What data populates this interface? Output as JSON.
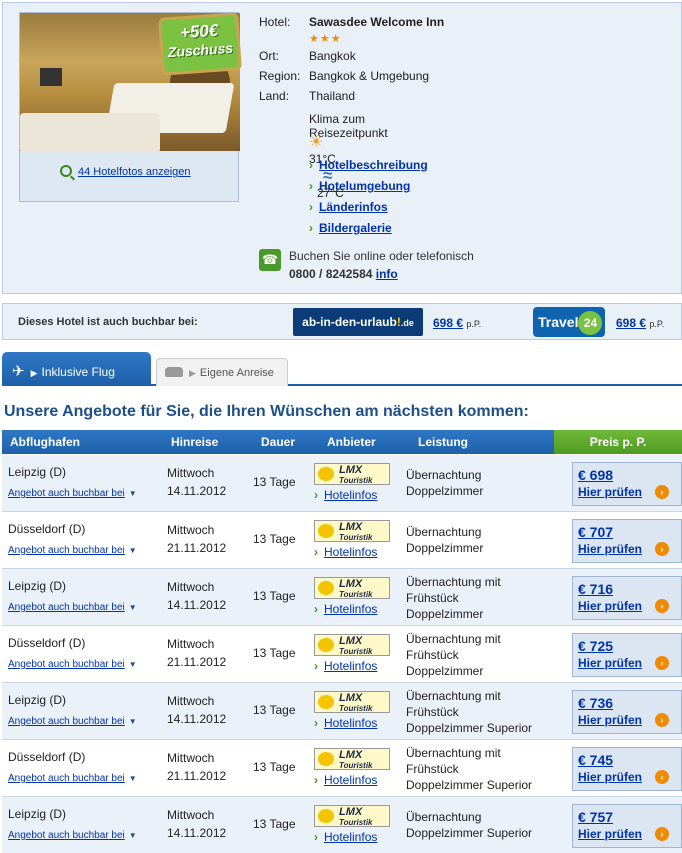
{
  "hotel": {
    "badge_line1": "+50€",
    "badge_line2": "Zuschuss",
    "photos_link": "44 Hotelfotos anzeigen",
    "labels": {
      "hotel": "Hotel:",
      "ort": "Ort:",
      "region": "Region:",
      "land": "Land:"
    },
    "name": "Sawasdee Welcome Inn",
    "stars": "★★★",
    "ort": "Bangkok",
    "region": "Bangkok & Umgebung",
    "land": "Thailand",
    "climate_title": "Klima zum Reisezeitpunkt",
    "air_temp": "31°C",
    "water_temp": "27°C",
    "links": [
      "Hotelbeschreibung",
      "Hotelumgebung",
      "Länderinfos",
      "Bildergalerie"
    ],
    "phone_text": "Buchen Sie online oder telefonisch",
    "phone_number": "0800 / 8242584",
    "phone_info": "info"
  },
  "also_bookable": {
    "label": "Dieses Hotel ist auch buchbar bei:",
    "partner1_logo_a": "ab-in-den-urlaub",
    "partner1_logo_b": "!",
    "partner1_logo_c": ".de",
    "partner1_price": "698 €",
    "partner2_logo": "Travel",
    "partner2_logo_num": "24",
    "partner2_price": "698 €",
    "pp": "p.P."
  },
  "tabs": {
    "active": "Inklusive Flug",
    "inactive": "Eigene Anreise"
  },
  "headline": "Unsere Angebote für Sie, die Ihren Wünschen am nächsten kommen:",
  "table": {
    "headers": {
      "abflughafen": "Abflughafen",
      "hinreise": "Hinreise",
      "dauer": "Dauer",
      "anbieter": "Anbieter",
      "leistung": "Leistung",
      "preis": "Preis p. P."
    },
    "also_link": "Angebot auch buchbar bei",
    "lmx": "LMX",
    "lmx_sub": "Touristik",
    "hotelinfos": "Hotelinfos",
    "check": "Hier prüfen",
    "rows": [
      {
        "airport": "Leipzig (D)",
        "weekday": "Mittwoch",
        "date": "14.11.2012",
        "duration": "13 Tage",
        "service1": "Übernachtung",
        "service2": "Doppelzimmer",
        "service3": "",
        "price": "€ 698"
      },
      {
        "airport": "Düsseldorf (D)",
        "weekday": "Mittwoch",
        "date": "21.11.2012",
        "duration": "13 Tage",
        "service1": "Übernachtung",
        "service2": "Doppelzimmer",
        "service3": "",
        "price": "€ 707"
      },
      {
        "airport": "Leipzig (D)",
        "weekday": "Mittwoch",
        "date": "14.11.2012",
        "duration": "13 Tage",
        "service1": "Übernachtung mit",
        "service2": "Frühstück",
        "service3": "Doppelzimmer",
        "price": "€ 716"
      },
      {
        "airport": "Düsseldorf (D)",
        "weekday": "Mittwoch",
        "date": "21.11.2012",
        "duration": "13 Tage",
        "service1": "Übernachtung mit",
        "service2": "Frühstück",
        "service3": "Doppelzimmer",
        "price": "€ 725"
      },
      {
        "airport": "Leipzig (D)",
        "weekday": "Mittwoch",
        "date": "14.11.2012",
        "duration": "13 Tage",
        "service1": "Übernachtung mit",
        "service2": "Frühstück",
        "service3": "Doppelzimmer Superior",
        "price": "€ 736"
      },
      {
        "airport": "Düsseldorf (D)",
        "weekday": "Mittwoch",
        "date": "21.11.2012",
        "duration": "13 Tage",
        "service1": "Übernachtung mit",
        "service2": "Frühstück",
        "service3": "Doppelzimmer Superior",
        "price": "€ 745"
      },
      {
        "airport": "Leipzig (D)",
        "weekday": "Mittwoch",
        "date": "14.11.2012",
        "duration": "13 Tage",
        "service1": "Übernachtung",
        "service2": "Doppelzimmer Superior",
        "service3": "",
        "price": "€ 757"
      }
    ]
  }
}
